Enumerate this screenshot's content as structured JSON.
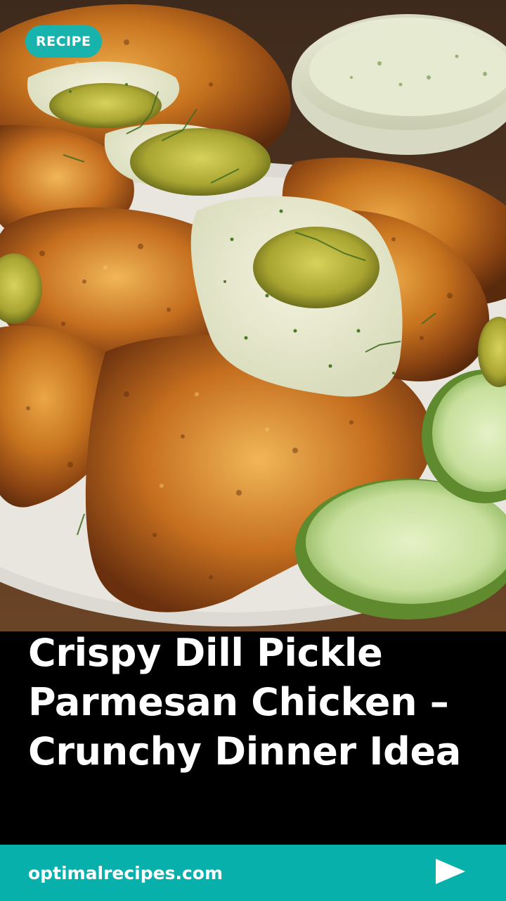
{
  "badge": {
    "label": "RECIPE"
  },
  "title": {
    "line1": "Crispy Dill Pickle",
    "line2": "Parmesan Chicken –",
    "line3": "Crunchy Dinner Idea"
  },
  "footer": {
    "site": "optimalrecipes.com",
    "play_icon": "play-triangle-icon"
  },
  "colors": {
    "accent": "#18b3ad",
    "footer_bg": "#08b0ac",
    "caption_bg": "#000000",
    "text": "#ffffff"
  },
  "hero": {
    "subject": "recipe-photo"
  }
}
